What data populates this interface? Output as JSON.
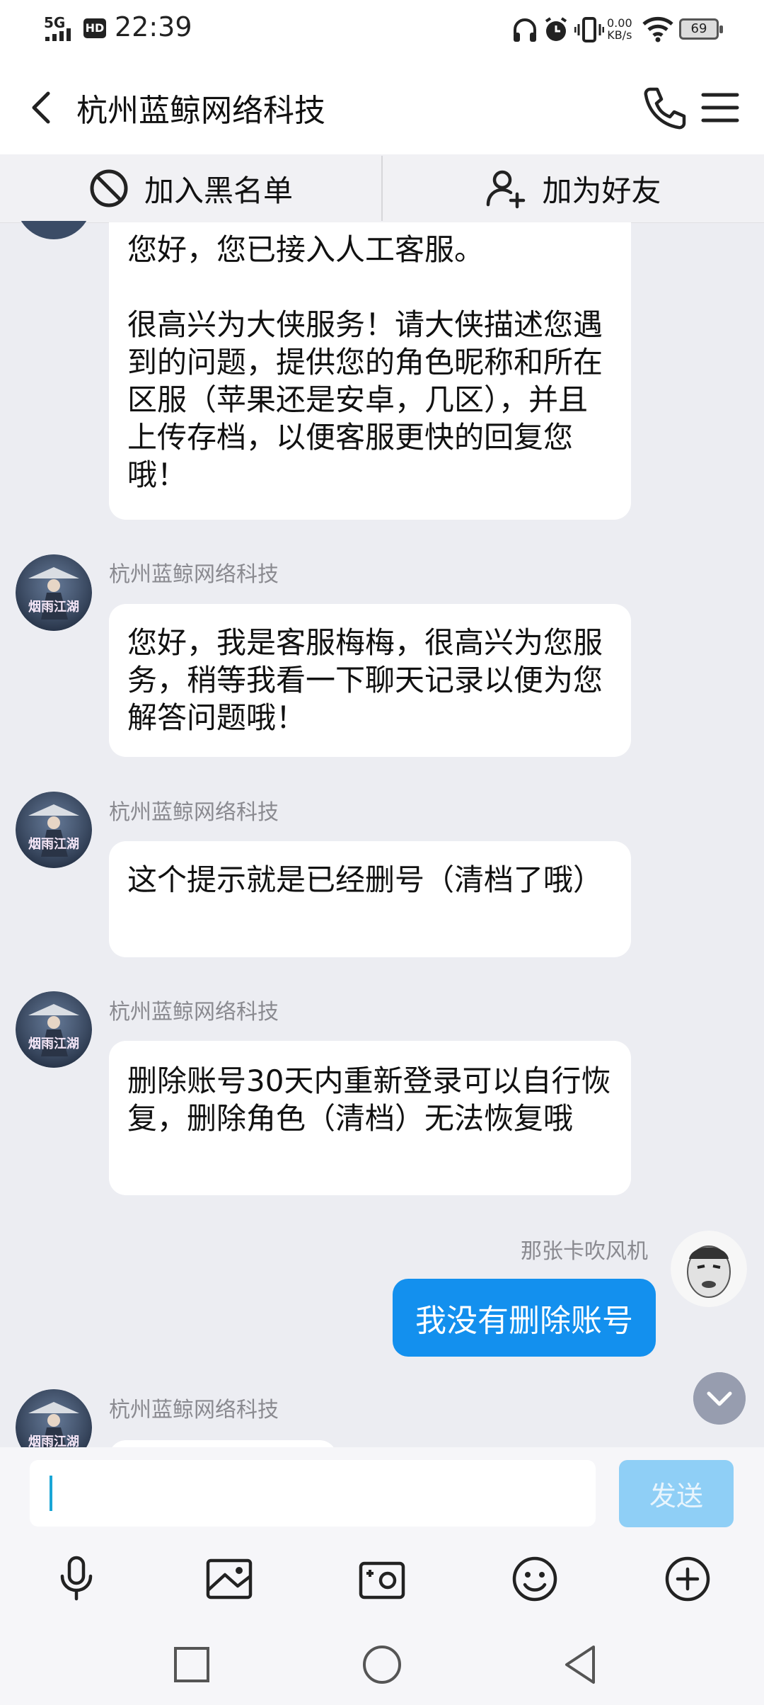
{
  "status_bar": {
    "time": "22:39",
    "network": "5G",
    "hd": "HD",
    "speed_value": "0.00",
    "speed_unit": "KB/s",
    "battery": "69"
  },
  "header": {
    "title": "杭州蓝鲸网络科技"
  },
  "actions": {
    "blacklist": "加入黑名单",
    "add_friend": "加为好友"
  },
  "messages": [
    {
      "text": "您好，您已接入人工客服。\n\n很高兴为大侠服务！请大侠描述您遇到的问题，提供您的角色昵称和所在区服（苹果还是安卓，几区），并且上传存档，以便客服更快的回复您哦！"
    },
    {
      "sender": "杭州蓝鲸网络科技",
      "avatar_text": "烟雨江湖",
      "text": "您好，我是客服梅梅，很高兴为您服务，稍等我看一下聊天记录以便为您解答问题哦！"
    },
    {
      "sender": "杭州蓝鲸网络科技",
      "avatar_text": "烟雨江湖",
      "text": "这个提示就是已经删号（清档了哦）"
    },
    {
      "sender": "杭州蓝鲸网络科技",
      "avatar_text": "烟雨江湖",
      "text": "删除账号30天内重新登录可以自行恢复，删除角色（清档）无法恢复哦"
    },
    {
      "sender": "那张卡吹风机",
      "text": "我没有删除账号"
    },
    {
      "sender": "杭州蓝鲸网络科技",
      "avatar_text": "烟雨江湖"
    }
  ],
  "composer": {
    "value": "",
    "send_label": "发送"
  },
  "icons": {
    "toolbar": [
      "microphone-icon",
      "image-icon",
      "camera-icon",
      "emoji-icon",
      "plus-icon"
    ],
    "nav": [
      "recent-apps-icon",
      "home-icon",
      "back-icon"
    ]
  },
  "colors": {
    "accent": "#1390ee",
    "send_disabled": "#8fcff6",
    "background": "#ecedf2"
  }
}
